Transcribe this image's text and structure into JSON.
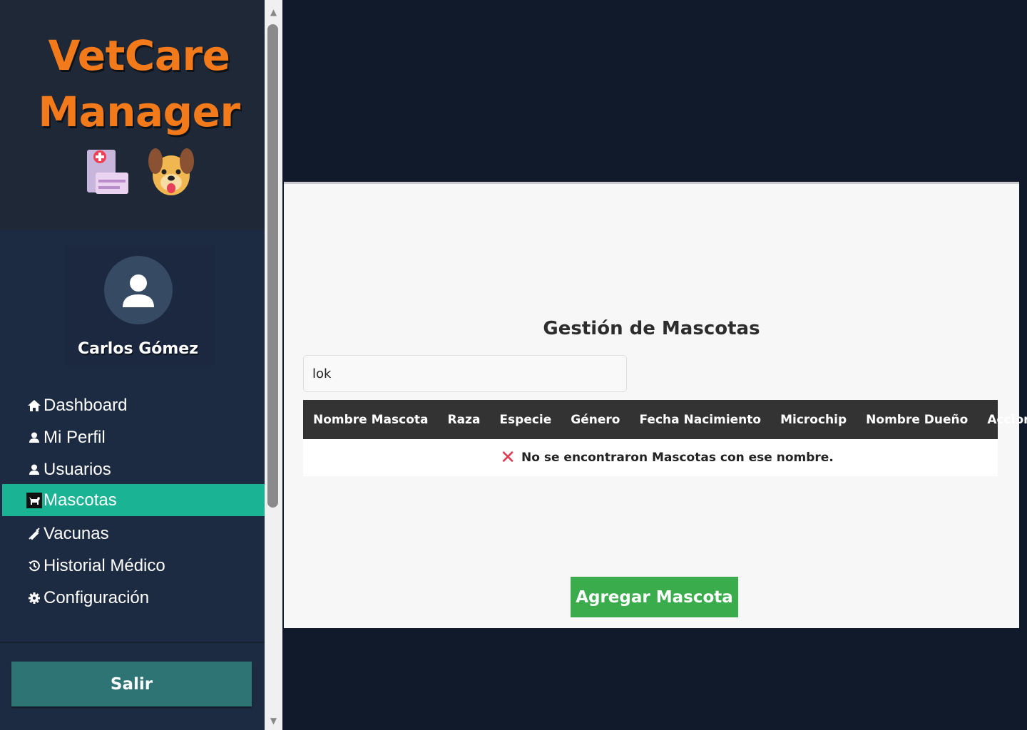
{
  "app": {
    "logo_line1": "VetCare",
    "logo_line2": "Manager",
    "logo_icons": [
      "clinic-card-icon",
      "dog-face-icon"
    ]
  },
  "user": {
    "name": "Carlos Gómez",
    "avatar_icon": "user-icon"
  },
  "nav": {
    "items": [
      {
        "label": "Dashboard",
        "icon": "home-icon"
      },
      {
        "label": "Mi Perfil",
        "icon": "user-icon"
      },
      {
        "label": "Usuarios",
        "icon": "user-icon"
      },
      {
        "label": "Mascotas",
        "icon": "dog-icon",
        "active": true
      },
      {
        "label": "Vacunas",
        "icon": "syringe-icon"
      },
      {
        "label": "Historial Médico",
        "icon": "history-icon"
      },
      {
        "label": "Configuración",
        "icon": "gear-icon"
      }
    ],
    "logout_label": "Salir"
  },
  "main": {
    "title": "Gestión de Mascotas",
    "search_value": "lok",
    "columns": [
      "Nombre Mascota",
      "Raza",
      "Especie",
      "Género",
      "Fecha Nacimiento",
      "Microchip",
      "Nombre Dueño",
      "Acciones"
    ],
    "empty_message": "No se encontraron Mascotas con ese nombre.",
    "add_button_label": "Agregar Mascota"
  },
  "colors": {
    "sidebar_bg": "#1d2b42",
    "page_bg": "#111a2b",
    "active_nav": "#1ab394",
    "logo_orange": "#f27a1a",
    "add_button": "#3aac4c",
    "logout_button": "#2e7475",
    "table_header": "#333333",
    "error_x": "#e53950"
  }
}
